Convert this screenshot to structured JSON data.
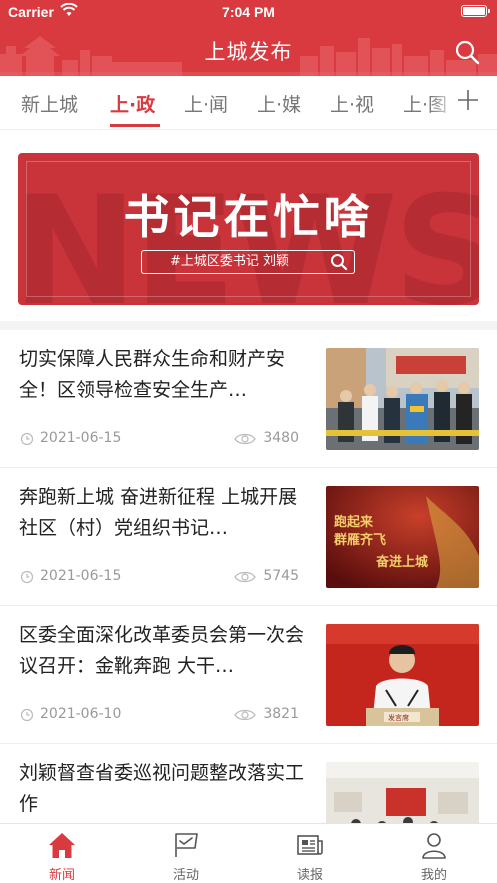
{
  "status_bar": {
    "carrier": "Carrier",
    "time": "7:04 PM"
  },
  "header": {
    "title": "上城发布"
  },
  "tabs": [
    {
      "label": "新上城"
    },
    {
      "label": "上·政"
    },
    {
      "label": "上·闻"
    },
    {
      "label": "上·媒"
    },
    {
      "label": "上·视"
    },
    {
      "label": "上·图"
    }
  ],
  "active_tab": "上·政",
  "banner": {
    "title": "书记在忙啥",
    "tag": "#上城区委书记 刘颖",
    "watermark": "NEWS",
    "dots": 2,
    "active_dot": 1
  },
  "news": [
    {
      "title": "切实保障人民群众生命和财产安全！区领导检查安全生产…",
      "date": "2021-06-15",
      "views": "3480"
    },
    {
      "title": "奔跑新上城 奋进新征程 上城开展社区（村）党组织书记…",
      "date": "2021-06-15",
      "views": "5745"
    },
    {
      "title": "区委全面深化改革委员会第一次会议召开：金靴奔跑 大干…",
      "date": "2021-06-10",
      "views": "3821"
    },
    {
      "title": "刘颖督查省委巡视问题整改落实工作",
      "date": "",
      "views": ""
    }
  ],
  "thumbs": {
    "t2_line1": "跑起来",
    "t2_line2": "群雁齐飞",
    "t2_line3": "奋进上城",
    "t3_nameplate": "发言席"
  },
  "bottom_nav": [
    {
      "label": "新闻",
      "icon": "home-icon"
    },
    {
      "label": "活动",
      "icon": "flag-icon"
    },
    {
      "label": "读报",
      "icon": "newspaper-icon"
    },
    {
      "label": "我的",
      "icon": "user-icon"
    }
  ],
  "active_nav": "新闻",
  "colors": {
    "brand": "#d93a3f",
    "text": "#222222",
    "muted": "#999999"
  }
}
